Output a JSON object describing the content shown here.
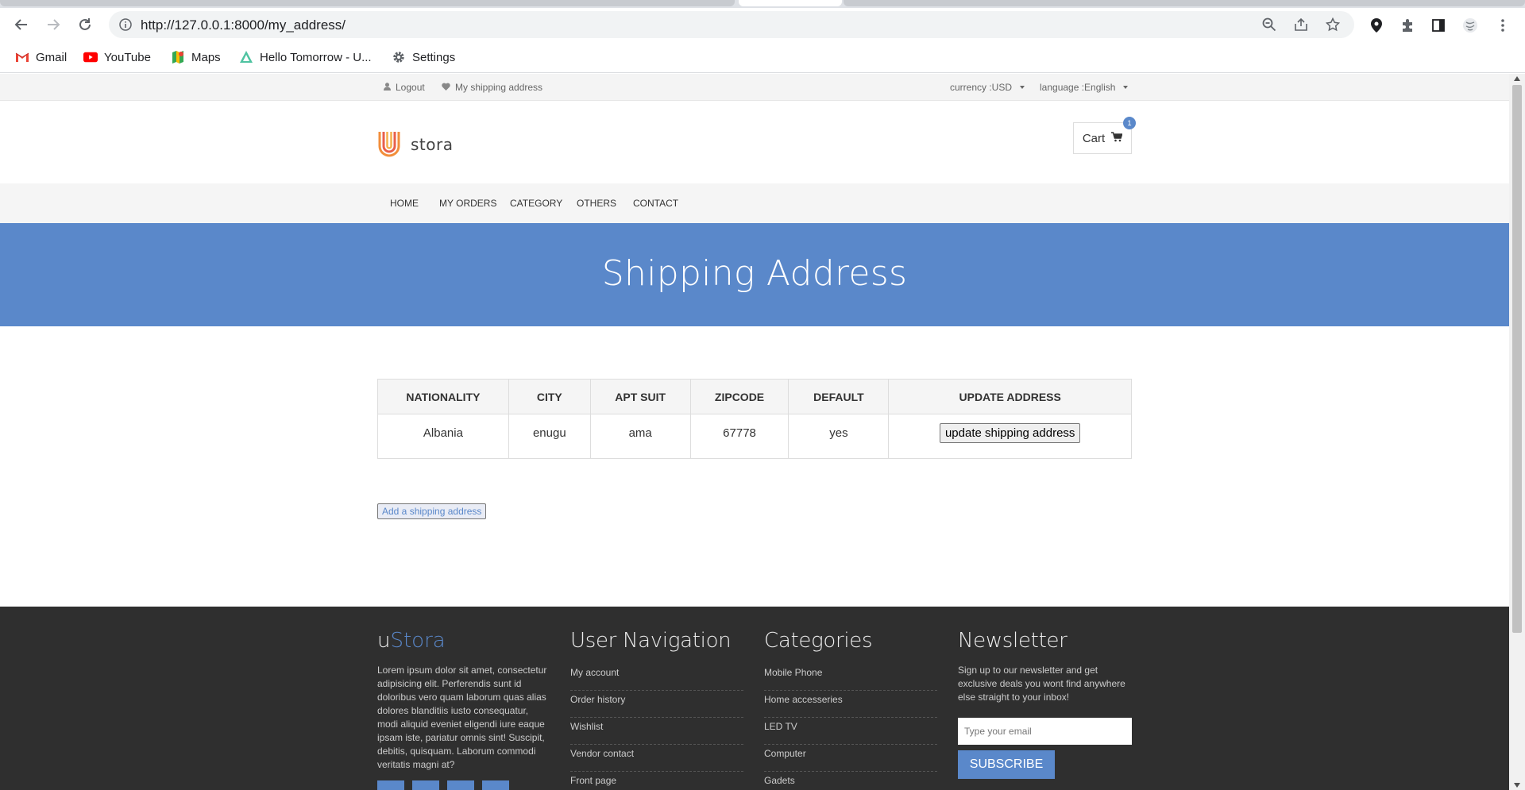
{
  "browser": {
    "url": "http://127.0.0.1:8000/my_address/",
    "bookmarks": [
      "Gmail",
      "YouTube",
      "Maps",
      "Hello Tomorrow - U...",
      "Settings"
    ]
  },
  "topbar": {
    "logout": "Logout",
    "shipping": "My shipping address",
    "currency": "currency :USD",
    "language": "language :English"
  },
  "header": {
    "logo_text": "stora",
    "cart_label": "Cart",
    "cart_count": "1"
  },
  "nav": [
    "HOME",
    "MY ORDERS",
    "CATEGORY",
    "OTHERS",
    "CONTACT"
  ],
  "banner": {
    "title": "Shipping Address"
  },
  "table": {
    "headers": [
      "NATIONALITY",
      "CITY",
      "APT SUIT",
      "ZIPCODE",
      "DEFAULT",
      "UPDATE ADDRESS"
    ],
    "rows": [
      {
        "nationality": "Albania",
        "city": "enugu",
        "apt": "ama",
        "zip": "67778",
        "default": "yes",
        "update_label": "update shipping address"
      }
    ]
  },
  "add_button": "Add a shipping address",
  "footer": {
    "brand_u": "u",
    "brand_rest": "Stora",
    "about": "Lorem ipsum dolor sit amet, consectetur adipisicing elit. Perferendis sunt id doloribus vero quam laborum quas alias dolores blanditiis iusto consequatur, modi aliquid eveniet eligendi iure eaque ipsam iste, pariatur omnis sint! Suscipit, debitis, quisquam. Laborum commodi veritatis magni at?",
    "user_nav_title": "User Navigation",
    "user_nav": [
      "My account",
      "Order history",
      "Wishlist",
      "Vendor contact",
      "Front page"
    ],
    "categories_title": "Categories",
    "categories": [
      "Mobile Phone",
      "Home accesseries",
      "LED TV",
      "Computer",
      "Gadets"
    ],
    "newsletter_title": "Newsletter",
    "newsletter_text": "Sign up to our newsletter and get exclusive deals you wont find anywhere else straight to your inbox!",
    "email_placeholder": "Type your email",
    "subscribe": "SUBSCRIBE"
  },
  "colors": {
    "accent": "#5a88ca",
    "footer_bg": "#2f2f2f",
    "topbar_bg": "#f4f4f4"
  }
}
